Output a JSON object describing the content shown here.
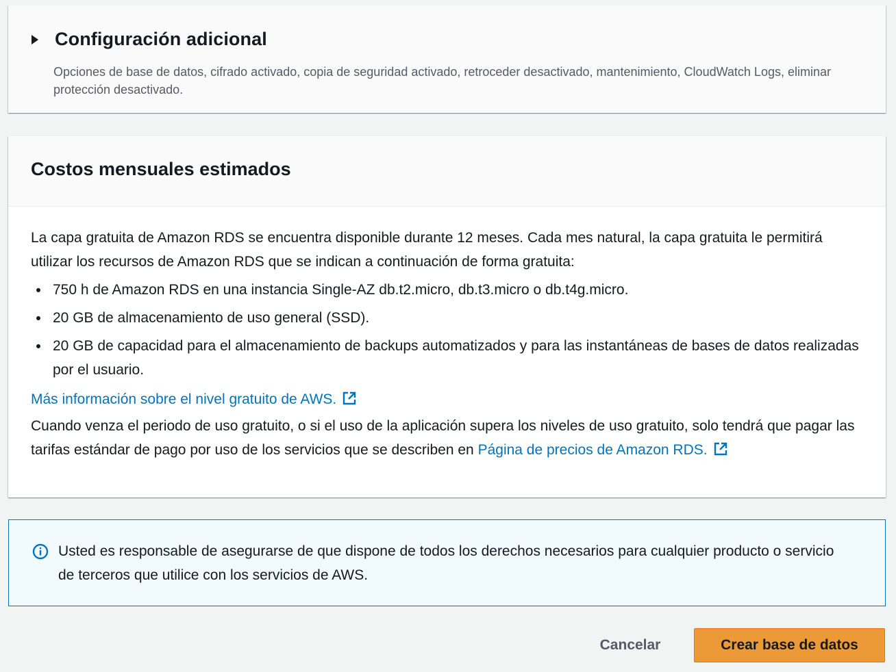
{
  "additional_config": {
    "title": "Configuración adicional",
    "description": "Opciones de base de datos, cifrado activado, copia de seguridad activado, retroceder desactivado, mantenimiento, CloudWatch Logs, eliminar protección desactivado."
  },
  "cost": {
    "title": "Costos mensuales estimados",
    "intro": "La capa gratuita de Amazon RDS se encuentra disponible durante 12 meses. Cada mes natural, la capa gratuita le permitirá utilizar los recursos de Amazon RDS que se indican a continuación de forma gratuita:",
    "bullets": [
      "750 h de Amazon RDS en una instancia Single-AZ db.t2.micro, db.t3.micro o db.t4g.micro.",
      "20 GB de almacenamiento de uso general (SSD).",
      "20 GB de capacidad para el almacenamiento de backups automatizados y para las instantáneas de bases de datos realizadas por el usuario."
    ],
    "free_tier_link": "Más información sobre el nivel gratuito de AWS.",
    "after_text": "Cuando venza el periodo de uso gratuito, o si el uso de la aplicación supera los niveles de uso gratuito, solo tendrá que pagar las tarifas estándar de pago por uso de los servicios que se describen en",
    "pricing_link": "Página de precios de Amazon RDS."
  },
  "alert": {
    "icon": "info-icon",
    "text": "Usted es responsable de asegurarse de que dispone de todos los derechos necesarios para cualquier producto o servicio de terceros que utilice con los servicios de AWS."
  },
  "actions": {
    "cancel_label": "Cancelar",
    "create_label": "Crear base de datos"
  },
  "colors": {
    "link": "#0073bb",
    "primary_button": "#ec9a38",
    "alert_background": "#f1faff"
  }
}
